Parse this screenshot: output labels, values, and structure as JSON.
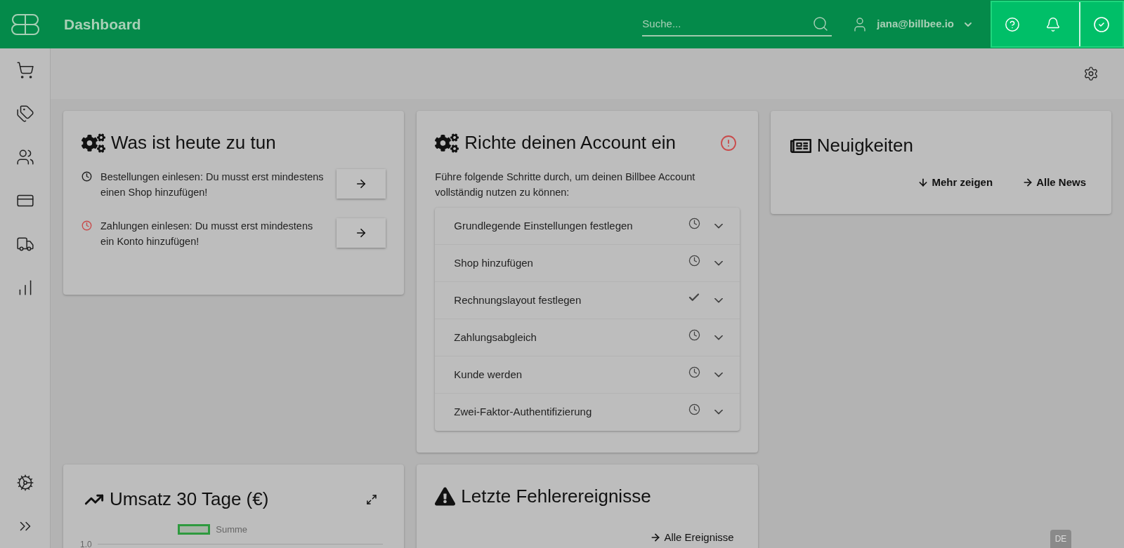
{
  "header": {
    "title": "Dashboard",
    "search": {
      "placeholder": "Suche..."
    },
    "user": "jana@billbee.io"
  },
  "sidebar": {
    "items": [
      {
        "kind": "cart"
      },
      {
        "kind": "tags"
      },
      {
        "kind": "users"
      },
      {
        "kind": "card"
      },
      {
        "kind": "truck"
      },
      {
        "kind": "chart"
      }
    ],
    "bottom": [
      {
        "kind": "settings"
      },
      {
        "kind": "expand"
      }
    ]
  },
  "todo": {
    "title": "Was ist heute zu tun",
    "tasks": [
      {
        "text": "Bestellungen einlesen: Du musst erst mindestens einen Shop hinzufügen!",
        "overdue": false
      },
      {
        "text": "Zahlungen einlesen: Du musst erst mindestens ein Konto hinzufügen!",
        "overdue": true
      }
    ]
  },
  "setup": {
    "title": "Richte deinen Account ein",
    "intro": "Führe folgende Schritte durch, um deinen Billbee Account vollständig nutzen zu können:",
    "steps": [
      {
        "label": "Grundlegende Einstellungen festlegen",
        "done": false,
        "expanded": false
      },
      {
        "label": "Shop hinzufügen",
        "done": false,
        "expanded": false
      },
      {
        "label": "Rechnungslayout festlegen",
        "done": true,
        "expanded": false
      },
      {
        "label": "Zahlungsabgleich",
        "done": false,
        "expanded": false
      },
      {
        "label": "Kunde werden",
        "done": false,
        "expanded": false
      },
      {
        "label": "Zwei-Faktor-Authentifizierung",
        "done": false,
        "expanded": false
      }
    ]
  },
  "news": {
    "title": "Neuigkeiten",
    "links": [
      {
        "label": "Mehr zeigen",
        "kind": "down"
      },
      {
        "label": "Alle News",
        "kind": "right"
      }
    ]
  },
  "revenue": {
    "title": "Umsatz 30 Tage (€)",
    "legend": "Summe",
    "y_tick": "1.0"
  },
  "errors": {
    "title": "Letzte Fehlerereignisse",
    "link": "Alle Ereignisse"
  },
  "language": "DE"
}
